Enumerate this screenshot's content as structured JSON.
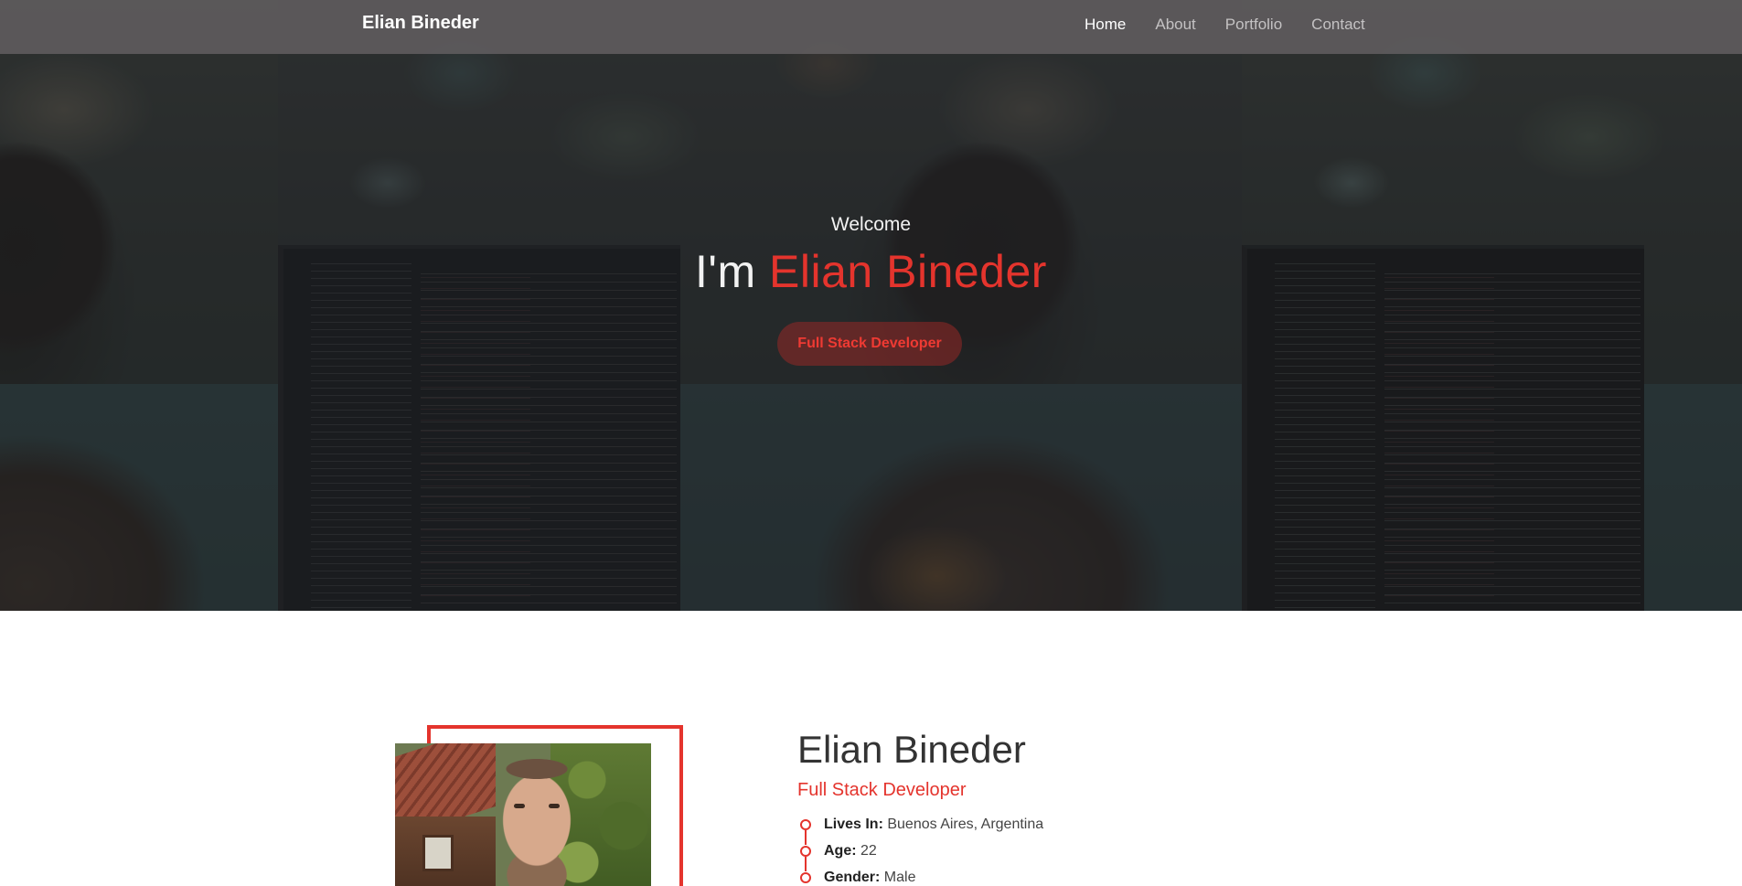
{
  "navbar": {
    "brand": "Elian Bineder",
    "links": [
      {
        "label": "Home",
        "active": true
      },
      {
        "label": "About",
        "active": false
      },
      {
        "label": "Portfolio",
        "active": false
      },
      {
        "label": "Contact",
        "active": false
      }
    ]
  },
  "hero": {
    "welcome": "Welcome",
    "title_prefix": "I'm",
    "title_name": "Elian Bineder",
    "badge": "Full Stack Developer"
  },
  "about": {
    "name": "Elian Bineder",
    "role": "Full Stack Developer",
    "facts": [
      {
        "label": "Lives In:",
        "value": "Buenos Aires, Argentina"
      },
      {
        "label": "Age:",
        "value": "22"
      },
      {
        "label": "Gender:",
        "value": "Male"
      }
    ]
  },
  "colors": {
    "accent": "#e4342d",
    "navbar": "#5e5b5d",
    "hero_overlay": "#1e1e20"
  }
}
